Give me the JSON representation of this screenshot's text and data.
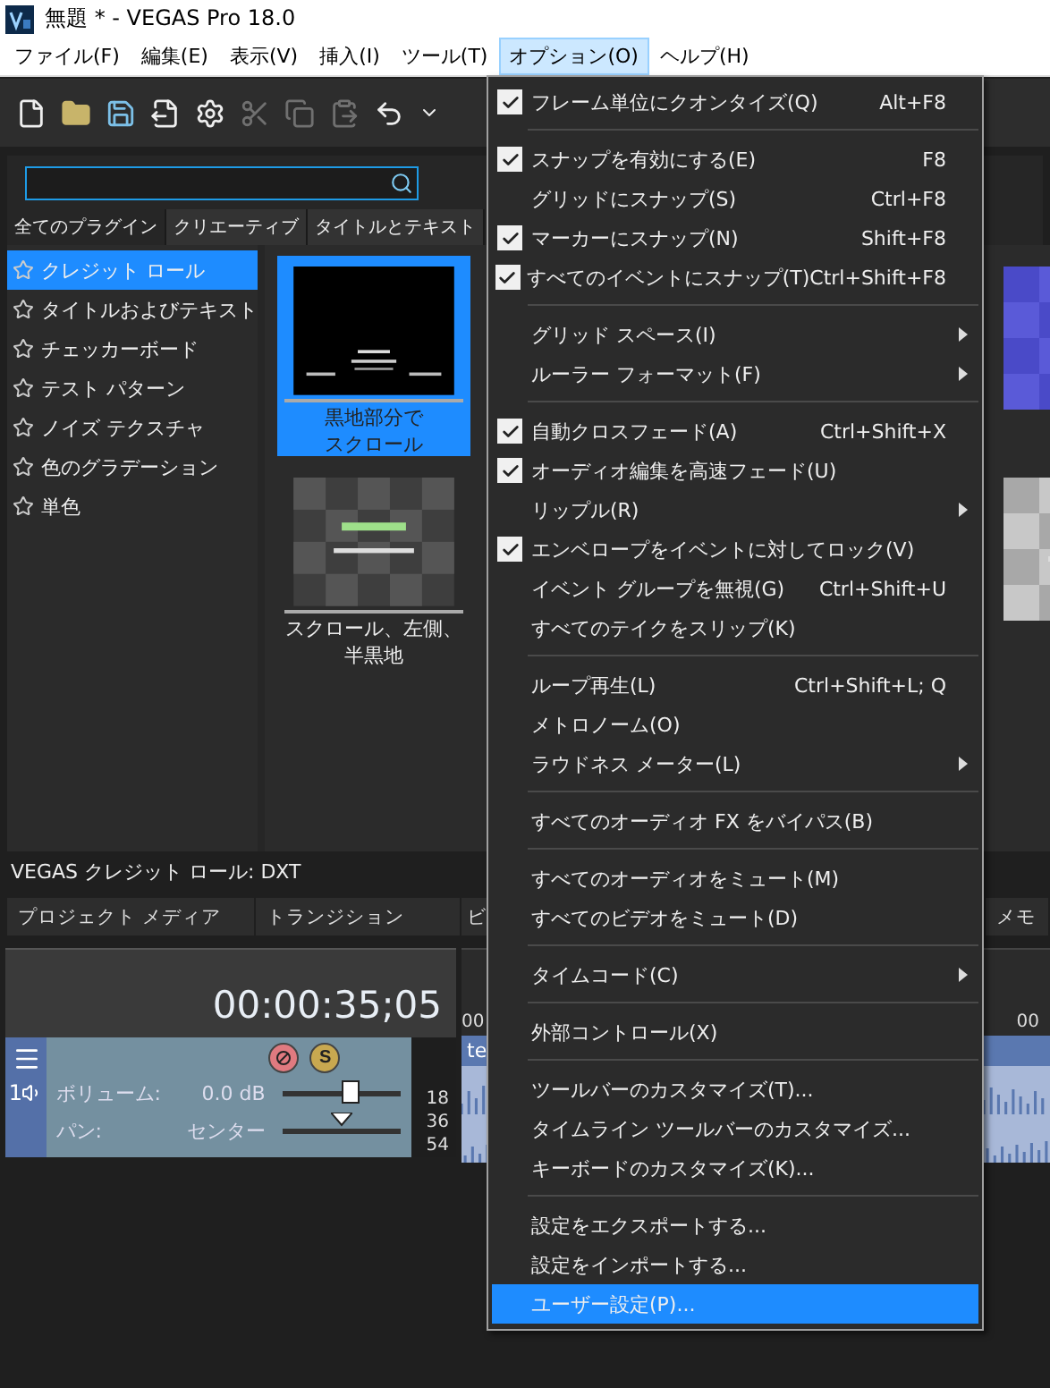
{
  "window": {
    "title": "無題 * - VEGAS Pro 18.0"
  },
  "menu_bar": [
    {
      "label": "ファイル(F)",
      "selected": false
    },
    {
      "label": "編集(E)",
      "selected": false
    },
    {
      "label": "表示(V)",
      "selected": false
    },
    {
      "label": "挿入(I)",
      "selected": false
    },
    {
      "label": "ツール(T)",
      "selected": false
    },
    {
      "label": "オプション(O)",
      "selected": true
    },
    {
      "label": "ヘルプ(H)",
      "selected": false
    }
  ],
  "toolbar": [
    {
      "kind": "new",
      "disabled": false
    },
    {
      "kind": "open",
      "disabled": false
    },
    {
      "kind": "save",
      "disabled": false
    },
    {
      "kind": "render",
      "disabled": false
    },
    {
      "kind": "properties",
      "disabled": false
    },
    {
      "kind": "cut",
      "disabled": true
    },
    {
      "kind": "copy",
      "disabled": true
    },
    {
      "kind": "paste",
      "disabled": true
    },
    {
      "kind": "undo",
      "disabled": false
    },
    {
      "kind": "dropdown",
      "disabled": false
    }
  ],
  "browser_tabs": [
    {
      "label": "全てのプラグイン",
      "selected": true
    },
    {
      "label": "クリエーティブ",
      "selected": false
    },
    {
      "label": "タイトルとテキスト",
      "selected": false
    }
  ],
  "plugins": [
    {
      "label": "クレジット ロール",
      "selected": true
    },
    {
      "label": "タイトルおよびテキスト",
      "selected": false
    },
    {
      "label": "チェッカーボード",
      "selected": false
    },
    {
      "label": "テスト パターン",
      "selected": false
    },
    {
      "label": "ノイズ テクスチャ",
      "selected": false
    },
    {
      "label": "色のグラデーション",
      "selected": false
    },
    {
      "label": "単色",
      "selected": false
    }
  ],
  "presets": [
    {
      "lines": [
        "黒地部分で",
        "スクロール"
      ],
      "selected": true
    },
    {
      "lines": [
        "スクロール、左側、",
        "半黒地"
      ],
      "selected": false
    }
  ],
  "status": "VEGAS クレジット ロール: DXT",
  "dock_tabs": [
    {
      "label": "プロジェクト メディア"
    },
    {
      "label": "トランジション"
    },
    {
      "label": "ビ"
    },
    {
      "label": "メモ"
    }
  ],
  "timecode": "00:00:35;05",
  "track": {
    "number": "1",
    "solo": "S",
    "volume_label": "ボリューム:",
    "volume": "0.0 dB",
    "volume_slider": {
      "level": 0.57
    },
    "pan_label": "パン:",
    "pan": "センター",
    "pan_slider": {
      "level": 0.5
    },
    "meter_ticks": [
      "18",
      "36",
      "54"
    ]
  },
  "timeline": {
    "ruler": [
      "00",
      "00"
    ],
    "event": "te"
  },
  "options_menu": [
    {
      "kind": "item",
      "label": "フレーム単位にクオンタイズ(Q)",
      "shortcut": "Alt+F8",
      "checked": true,
      "submenu": false,
      "selected": false
    },
    {
      "kind": "separator"
    },
    {
      "kind": "item",
      "label": "スナップを有効にする(E)",
      "shortcut": "F8",
      "checked": true,
      "submenu": false,
      "selected": false
    },
    {
      "kind": "item",
      "label": "グリッドにスナップ(S)",
      "shortcut": "Ctrl+F8",
      "checked": false,
      "submenu": false,
      "selected": false
    },
    {
      "kind": "item",
      "label": "マーカーにスナップ(N)",
      "shortcut": "Shift+F8",
      "checked": true,
      "submenu": false,
      "selected": false
    },
    {
      "kind": "item",
      "label": "すべてのイベントにスナップ(T)",
      "shortcut": "Ctrl+Shift+F8",
      "checked": true,
      "submenu": false,
      "selected": false
    },
    {
      "kind": "separator"
    },
    {
      "kind": "item",
      "label": "グリッド スペース(I)",
      "checked": false,
      "submenu": true,
      "selected": false
    },
    {
      "kind": "item",
      "label": "ルーラー フォーマット(F)",
      "checked": false,
      "submenu": true,
      "selected": false
    },
    {
      "kind": "separator"
    },
    {
      "kind": "item",
      "label": "自動クロスフェード(A)",
      "shortcut": "Ctrl+Shift+X",
      "checked": true,
      "submenu": false,
      "selected": false
    },
    {
      "kind": "item",
      "label": "オーディオ編集を高速フェード(U)",
      "checked": true,
      "submenu": false,
      "selected": false
    },
    {
      "kind": "item",
      "label": "リップル(R)",
      "checked": false,
      "submenu": true,
      "selected": false
    },
    {
      "kind": "item",
      "label": "エンベロープをイベントに対してロック(V)",
      "checked": true,
      "submenu": false,
      "selected": false
    },
    {
      "kind": "item",
      "label": "イベント グループを無視(G)",
      "shortcut": "Ctrl+Shift+U",
      "checked": false,
      "submenu": false,
      "selected": false
    },
    {
      "kind": "item",
      "label": "すべてのテイクをスリップ(K)",
      "checked": false,
      "submenu": false,
      "selected": false
    },
    {
      "kind": "separator"
    },
    {
      "kind": "item",
      "label": "ループ再生(L)",
      "shortcut": "Ctrl+Shift+L; Q",
      "checked": false,
      "submenu": false,
      "selected": false
    },
    {
      "kind": "item",
      "label": "メトロノーム(O)",
      "checked": false,
      "submenu": false,
      "selected": false
    },
    {
      "kind": "item",
      "label": "ラウドネス メーター(L)",
      "checked": false,
      "submenu": true,
      "selected": false
    },
    {
      "kind": "separator"
    },
    {
      "kind": "item",
      "label": "すべてのオーディオ FX をバイパス(B)",
      "checked": false,
      "submenu": false,
      "selected": false
    },
    {
      "kind": "separator"
    },
    {
      "kind": "item",
      "label": "すべてのオーディオをミュート(M)",
      "checked": false,
      "submenu": false,
      "selected": false
    },
    {
      "kind": "item",
      "label": "すべてのビデオをミュート(D)",
      "checked": false,
      "submenu": false,
      "selected": false
    },
    {
      "kind": "separator"
    },
    {
      "kind": "item",
      "label": "タイムコード(C)",
      "checked": false,
      "submenu": true,
      "selected": false
    },
    {
      "kind": "separator"
    },
    {
      "kind": "item",
      "label": "外部コントロール(X)",
      "checked": false,
      "submenu": false,
      "selected": false
    },
    {
      "kind": "separator"
    },
    {
      "kind": "item",
      "label": "ツールバーのカスタマイズ(T)...",
      "checked": false,
      "submenu": false,
      "selected": false
    },
    {
      "kind": "item",
      "label": "タイムライン ツールバーのカスタマイズ...",
      "checked": false,
      "submenu": false,
      "selected": false
    },
    {
      "kind": "item",
      "label": "キーボードのカスタマイズ(K)...",
      "checked": false,
      "submenu": false,
      "selected": false
    },
    {
      "kind": "separator"
    },
    {
      "kind": "item",
      "label": "設定をエクスポートする...",
      "checked": false,
      "submenu": false,
      "selected": false
    },
    {
      "kind": "item",
      "label": "設定をインポートする...",
      "checked": false,
      "submenu": false,
      "selected": false
    },
    {
      "kind": "item",
      "label": "ユーザー設定(P)...",
      "checked": false,
      "submenu": false,
      "selected": true
    }
  ]
}
